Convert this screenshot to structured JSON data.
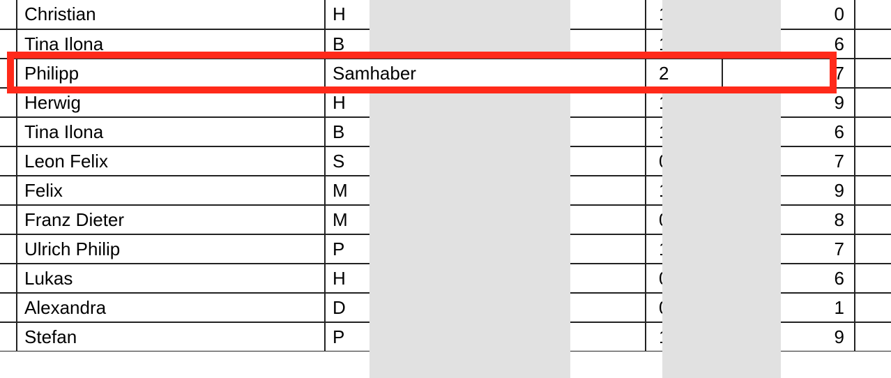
{
  "rows": [
    {
      "first": "Christian",
      "last": "H",
      "n1": "1",
      "n2": "0"
    },
    {
      "first": "Tina Ilona",
      "last": "B",
      "n1": "1",
      "n2": "6"
    },
    {
      "first": "Philipp",
      "last": "Samhaber",
      "n1": "2",
      "n2": "7"
    },
    {
      "first": "Herwig",
      "last": "H",
      "n1": "1",
      "n2": "9"
    },
    {
      "first": "Tina Ilona",
      "last": "B",
      "n1": "1",
      "n2": "6"
    },
    {
      "first": "Leon Felix",
      "last": "S",
      "n1": "0",
      "n2": "7"
    },
    {
      "first": "Felix",
      "last": "M",
      "n1": "1",
      "n2": "9"
    },
    {
      "first": "Franz Dieter",
      "last": "M",
      "n1": "0",
      "n2": "8"
    },
    {
      "first": "Ulrich Philip",
      "last": "P",
      "n1": "1",
      "n2": "7"
    },
    {
      "first": "Lukas",
      "last": "H",
      "n1": "0",
      "n2": "6"
    },
    {
      "first": "Alexandra",
      "last": "D",
      "n1": "0",
      "n2": "1"
    },
    {
      "first": "Stefan",
      "last": "P",
      "n1": "1",
      "n2": "9"
    }
  ],
  "highlight_index": 2
}
